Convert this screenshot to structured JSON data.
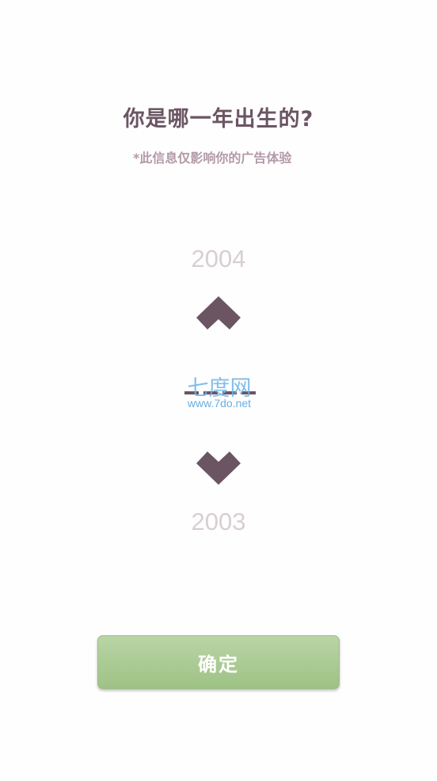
{
  "header": {
    "title": "你是哪一年出生的?",
    "subtitle": "*此信息仅影响你的广告体验"
  },
  "picker": {
    "previous_year": "2004",
    "current_value": "----",
    "next_year": "2003",
    "up_icon": "chevron-up-icon",
    "down_icon": "chevron-down-icon"
  },
  "watermark": {
    "main_text": "七度网",
    "url_text": "www.7do.net"
  },
  "confirm_button": {
    "label": "确定"
  },
  "colors": {
    "primary_text": "#6b5563",
    "secondary_text": "#b39aa8",
    "faded_year": "#d8ced4",
    "button": "#a9c992",
    "watermark": "#6fb4e8"
  }
}
